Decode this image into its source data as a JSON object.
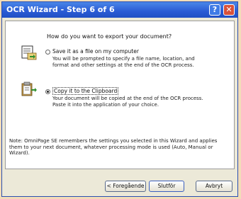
{
  "window": {
    "title": "OCR Wizard - Step 6 of 6",
    "help_label": "?",
    "close_label": "✕"
  },
  "question": "How do you want to export your document?",
  "options": [
    {
      "label": "Save it as a file on  my computer",
      "description": "You will be prompted to specify a file name, location, and format and other settings at the end of the OCR process.",
      "selected": false
    },
    {
      "label": "Copy it to the Clipboard",
      "description": "Your document will be copied at the end of the OCR process. Paste it into the application of your choice.",
      "selected": true
    }
  ],
  "note": "Note: OmniPage SE remembers the settings you selected in this Wizard and applies them to your next document, whatever processing mode is used (Auto, Manual or Wizard).",
  "buttons": {
    "back": "< Foregående",
    "finish": "Slutför",
    "cancel": "Avbryt"
  },
  "icons": [
    "save-to-file-icon",
    "clipboard-icon"
  ]
}
